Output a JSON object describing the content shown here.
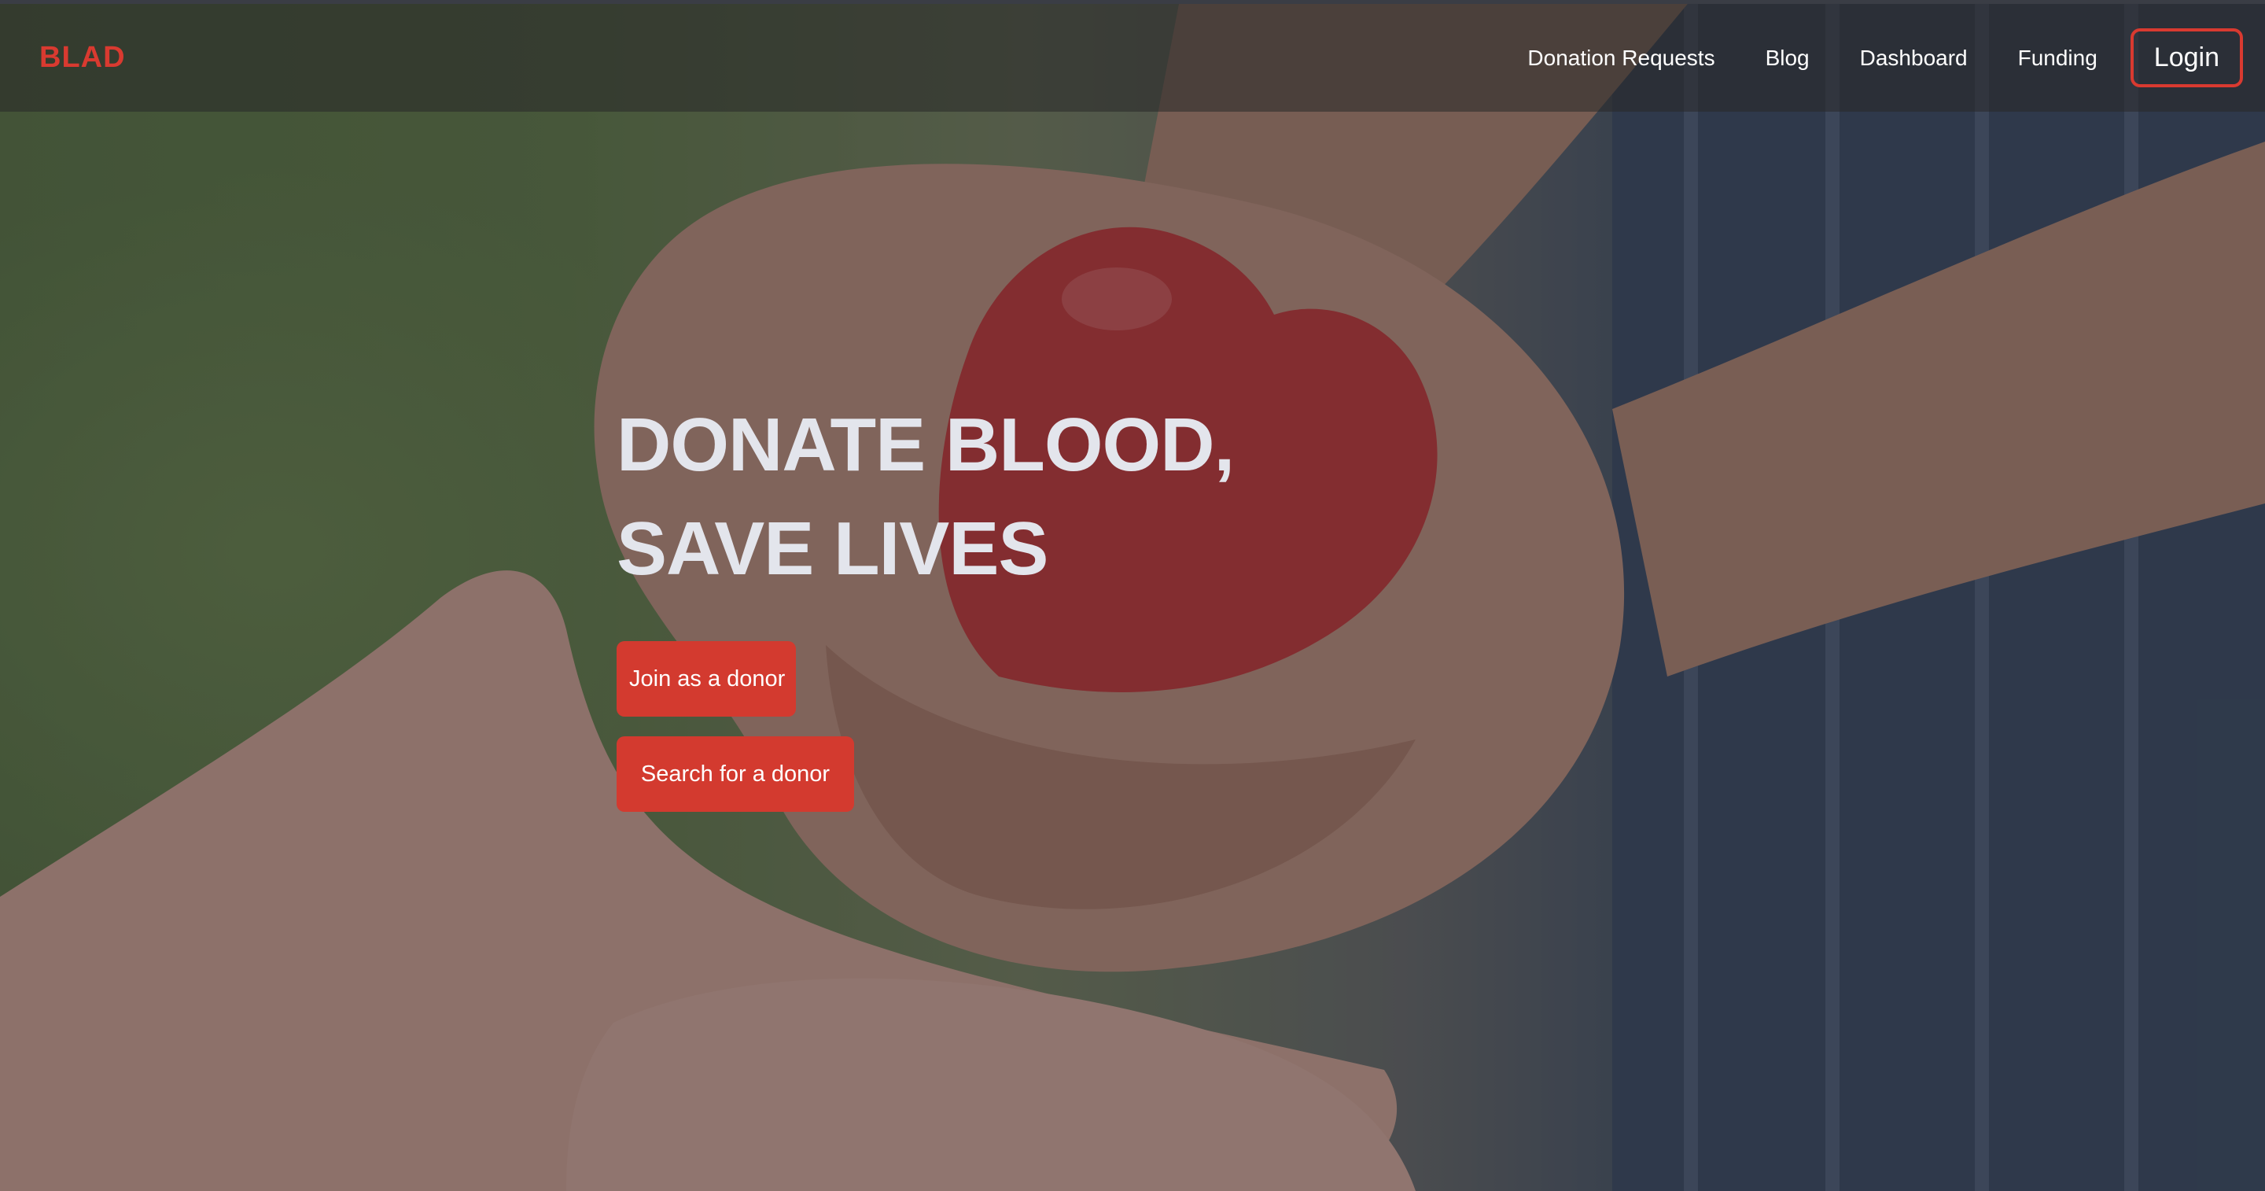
{
  "brand": {
    "name": "BLAD",
    "color": "#d93a30"
  },
  "nav": {
    "links": [
      "Donation Requests",
      "Blog",
      "Dashboard",
      "Funding"
    ],
    "login_label": "Login"
  },
  "hero": {
    "title_line1": "DONATE BLOOD,",
    "title_line2": "SAVE LIVES",
    "cta_primary": "Join as a donor",
    "cta_secondary": "Search for a donor",
    "accent_color": "#d33a2f"
  }
}
